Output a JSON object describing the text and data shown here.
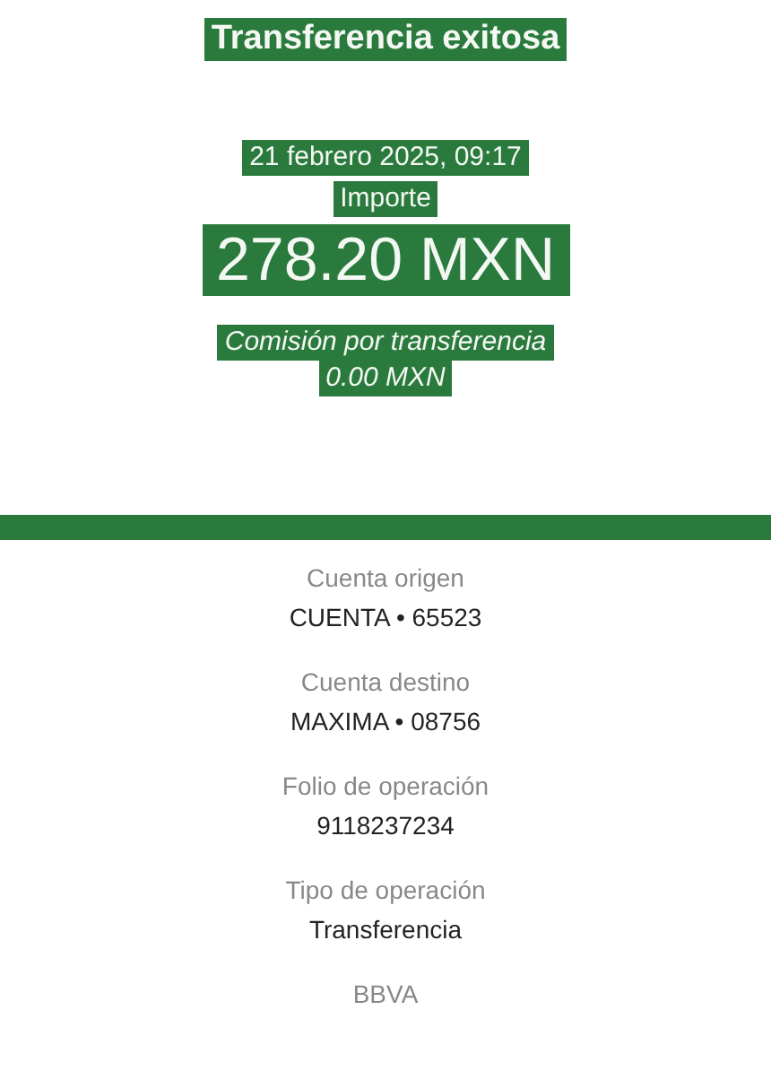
{
  "header": {
    "title": "Transferencia exitosa",
    "date": "21 febrero 2025, 09:17",
    "amount_label": "Importe",
    "amount": "278.20 MXN",
    "fee_label": "Comisión por transferencia",
    "fee": "0.00 MXN"
  },
  "details": [
    {
      "label": "Cuenta origen",
      "value": "CUENTA • 65523"
    },
    {
      "label": "Cuenta destino",
      "value": "MAXIMA • 08756"
    },
    {
      "label": "Folio de operación",
      "value": "9118237234"
    },
    {
      "label": "Tipo de operación",
      "value": "Transferencia"
    },
    {
      "label": "BBVA"
    }
  ]
}
